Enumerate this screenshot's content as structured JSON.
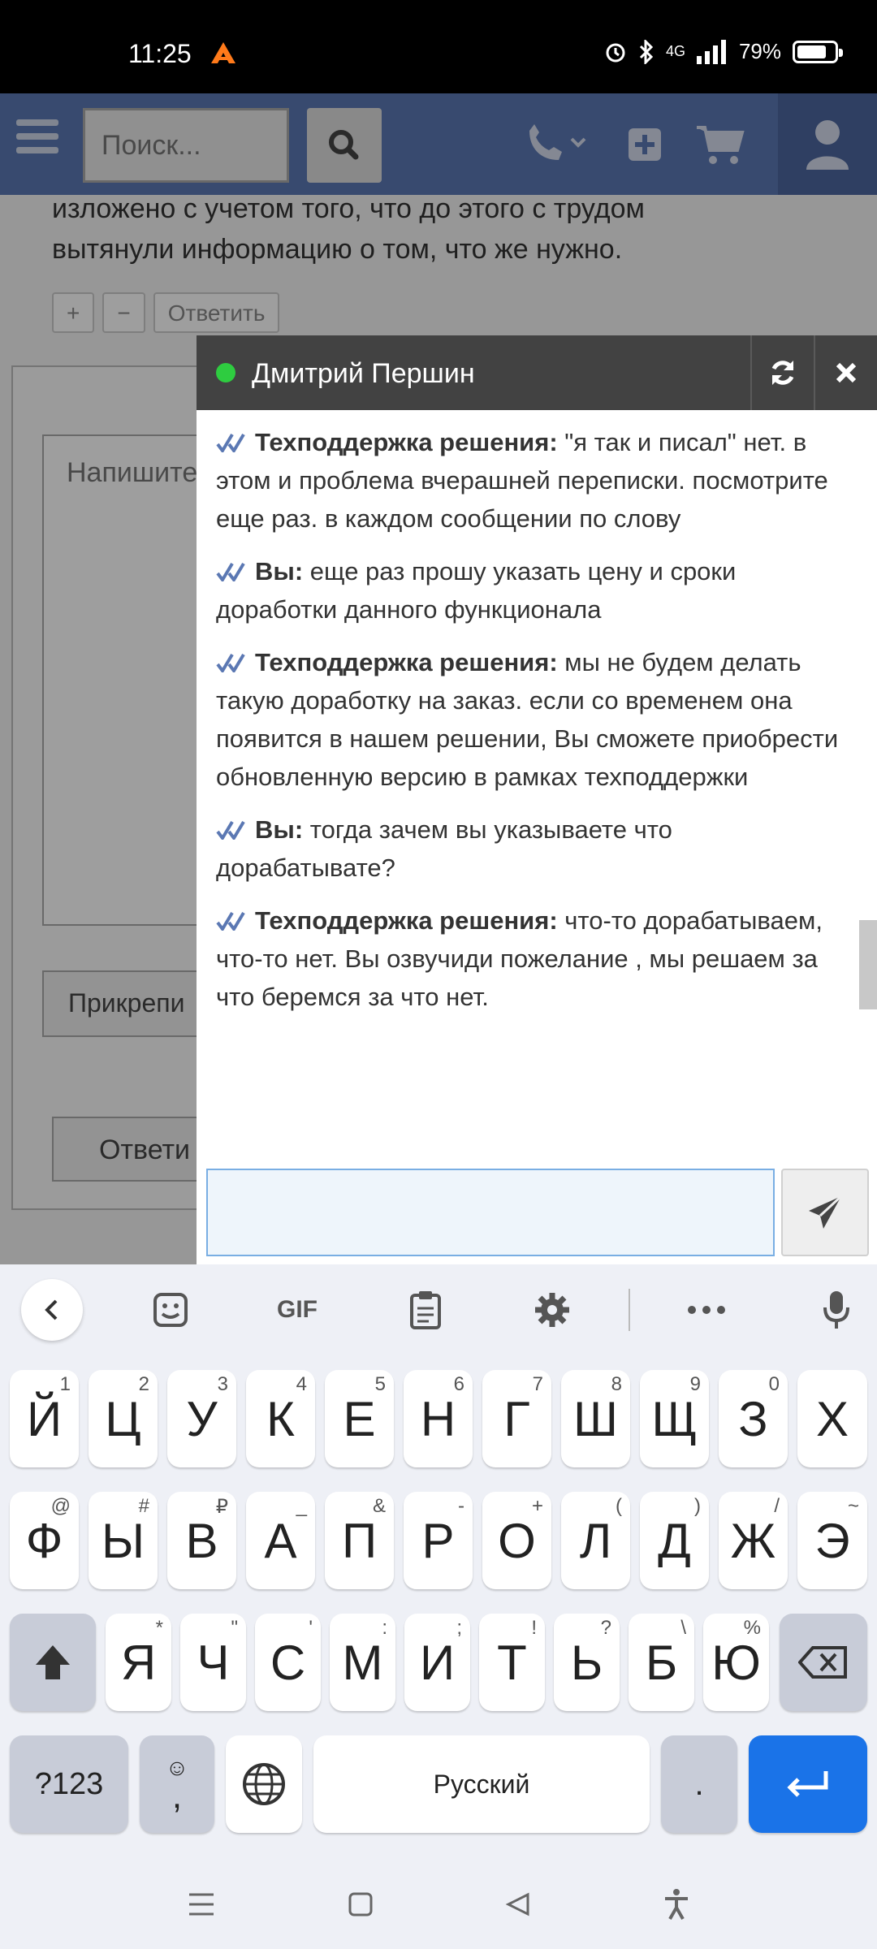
{
  "status_bar": {
    "time": "11:25",
    "network": "4G",
    "battery": "79%",
    "battery_level": 0.79
  },
  "header": {
    "search_placeholder": "Поиск..."
  },
  "background": {
    "text": "изложено с учетом того, что до этого с трудом вытянули информацию о том, что же нужно.",
    "actions": [
      "+",
      "−",
      "Ответить"
    ],
    "textarea_placeholder": "Напишите",
    "attach_label": "Прикрепи",
    "reply_label": "Ответи"
  },
  "chat": {
    "contact_name": "Дмитрий Першин",
    "messages": [
      {
        "author": "Техподдержка решения:",
        "text": " \"я так и писал\" нет. в этом и проблема вчерашней переписки. посмотрите еще раз. в каждом сообщении по слову"
      },
      {
        "author": "Вы:",
        "text": " еще раз прошу указать цену и сроки доработки данного функционала"
      },
      {
        "author": "Техподдержка решения:",
        "text": " мы не будем делать такую доработку на заказ. если со временем она появится в нашем решении, Вы сможете приобрести обновленную версию в рамках техподдержки"
      },
      {
        "author": "Вы:",
        "text": " тогда зачем вы указываете что дорабатывате?"
      },
      {
        "author": "Техподдержка решения:",
        "text": " что-то дорабатываем, что-то нет. Вы озвучиди пожелание , мы решаем за что беремся за что нет."
      }
    ],
    "input_value": ""
  },
  "keyboard": {
    "toolbar": {
      "gif_label": "GIF"
    },
    "row1": [
      {
        "key": "Й",
        "hint": "1"
      },
      {
        "key": "Ц",
        "hint": "2"
      },
      {
        "key": "У",
        "hint": "3"
      },
      {
        "key": "К",
        "hint": "4"
      },
      {
        "key": "Е",
        "hint": "5"
      },
      {
        "key": "Н",
        "hint": "6"
      },
      {
        "key": "Г",
        "hint": "7"
      },
      {
        "key": "Ш",
        "hint": "8"
      },
      {
        "key": "Щ",
        "hint": "9"
      },
      {
        "key": "З",
        "hint": "0"
      },
      {
        "key": "Х",
        "hint": ""
      }
    ],
    "row2": [
      {
        "key": "Ф",
        "hint": "@"
      },
      {
        "key": "Ы",
        "hint": "#"
      },
      {
        "key": "В",
        "hint": "₽"
      },
      {
        "key": "А",
        "hint": "_"
      },
      {
        "key": "П",
        "hint": "&"
      },
      {
        "key": "Р",
        "hint": "-"
      },
      {
        "key": "О",
        "hint": "+"
      },
      {
        "key": "Л",
        "hint": "("
      },
      {
        "key": "Д",
        "hint": ")"
      },
      {
        "key": "Ж",
        "hint": "/"
      },
      {
        "key": "Э",
        "hint": "~"
      }
    ],
    "row3": [
      {
        "key": "Я",
        "hint": "*"
      },
      {
        "key": "Ч",
        "hint": "\""
      },
      {
        "key": "С",
        "hint": "'"
      },
      {
        "key": "М",
        "hint": ":"
      },
      {
        "key": "И",
        "hint": ";"
      },
      {
        "key": "Т",
        "hint": "!"
      },
      {
        "key": "Ь",
        "hint": "?"
      },
      {
        "key": "Б",
        "hint": "\\"
      },
      {
        "key": "Ю",
        "hint": "%"
      }
    ],
    "symbols_label": "?123",
    "comma_label": ",",
    "emoji_hint": "☺",
    "space_label": "Русский",
    "period_label": "."
  },
  "colors": {
    "nav_bar": "#5b78b3",
    "chat_header": "#424242",
    "online": "#2ecc40",
    "enter_key": "#1a73e8"
  }
}
